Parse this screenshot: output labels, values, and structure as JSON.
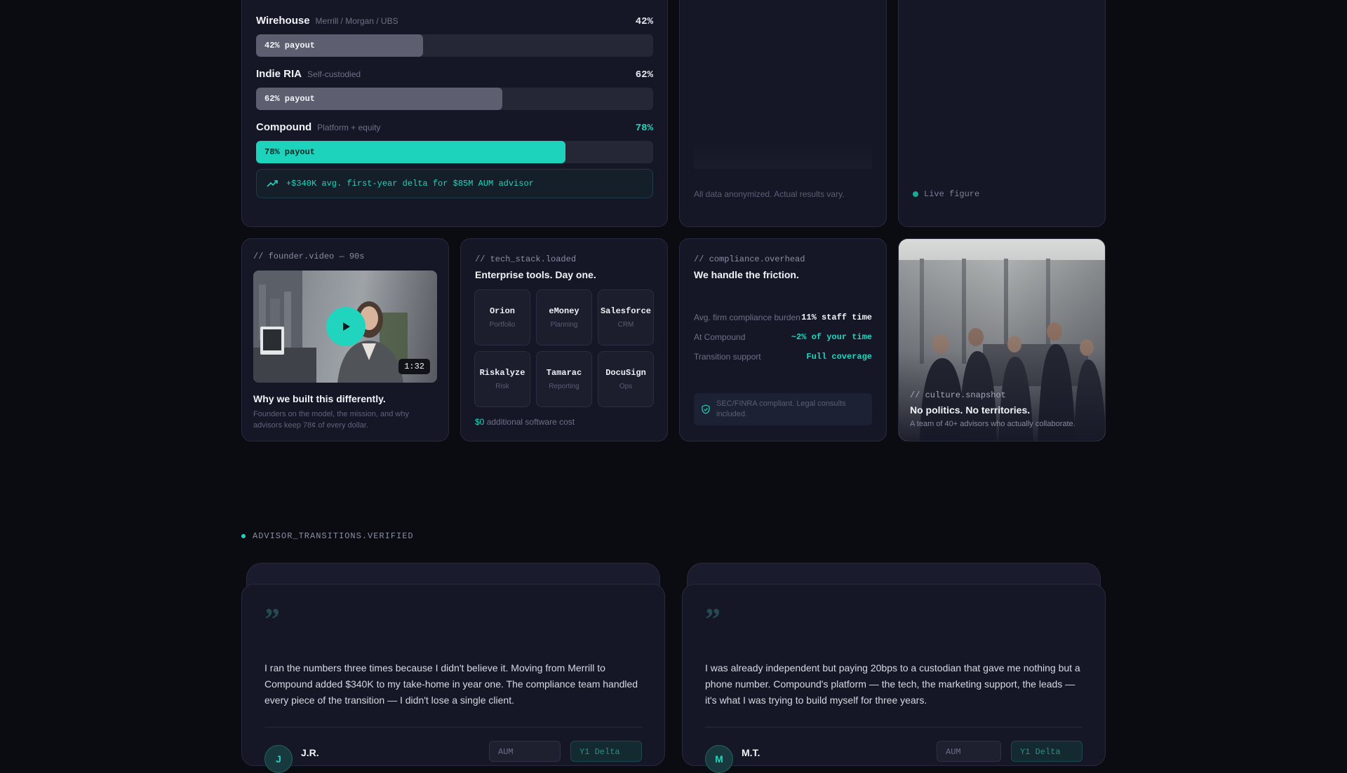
{
  "payout": {
    "rows": [
      {
        "name": "Wirehouse",
        "sub": "Merrill / Morgan / UBS",
        "pct": "42%",
        "bar_label": "42% payout",
        "value": 42,
        "accent": false
      },
      {
        "name": "Indie RIA",
        "sub": "Self-custodied",
        "pct": "62%",
        "bar_label": "62% payout",
        "value": 62,
        "accent": false
      },
      {
        "name": "Compound",
        "sub": "Platform + equity",
        "pct": "78%",
        "bar_label": "78% payout",
        "value": 78,
        "accent": true
      }
    ],
    "delta_text": "+$340K avg. first-year delta for $85M AUM advisor"
  },
  "disclaimer_card": {
    "note": "All data anonymized. Actual results vary."
  },
  "live_card": {
    "label": "Live figure"
  },
  "founder": {
    "label": "// founder.video — 90s",
    "duration": "1:32",
    "title": "Why we built this differently.",
    "desc": "Founders on the model, the mission, and why advisors keep 78¢ of every dollar."
  },
  "tech": {
    "label": "// tech_stack.loaded",
    "title": "Enterprise tools. Day one.",
    "tools": [
      {
        "name": "Orion",
        "role": "Portfolio"
      },
      {
        "name": "eMoney",
        "role": "Planning"
      },
      {
        "name": "Salesforce",
        "role": "CRM"
      },
      {
        "name": "Riskalyze",
        "role": "Risk"
      },
      {
        "name": "Tamarac",
        "role": "Reporting"
      },
      {
        "name": "DocuSign",
        "role": "Ops"
      }
    ],
    "cost_value": "$0",
    "cost_text": "additional software cost"
  },
  "compliance": {
    "label": "// compliance.overhead",
    "title": "We handle the friction.",
    "rows": [
      {
        "k": "Avg. firm compliance burden",
        "v": "11% staff time",
        "accent": false
      },
      {
        "k": "At Compound",
        "v": "~2% of your time",
        "accent": true
      },
      {
        "k": "Transition support",
        "v": "Full coverage",
        "accent": true
      }
    ],
    "badge": "SEC/FINRA compliant. Legal consults included."
  },
  "culture": {
    "label": "// culture.snapshot",
    "title": "No politics. No territories.",
    "desc": "A team of 40+ advisors who actually collaborate."
  },
  "section": {
    "label": "ADVISOR_TRANSITIONS.VERIFIED"
  },
  "testimonials": [
    {
      "quote": "I ran the numbers three times because I didn't believe it. Moving from Merrill to Compound added $340K to my take-home in year one. The compliance team handled every piece of the transition — I didn't lose a single client.",
      "initial": "J",
      "name": "J.R.",
      "aum_label": "AUM",
      "delta_label": "Y1 Delta"
    },
    {
      "quote": "I was already independent but paying 20bps to a custodian that gave me nothing but a phone number. Compound's platform — the tech, the marketing support, the leads — it's what I was trying to build myself for three years.",
      "initial": "M",
      "name": "M.T.",
      "aum_label": "AUM",
      "delta_label": "Y1 Delta"
    }
  ],
  "quote_glyph": "”",
  "colors": {
    "accent": "#1dd3bc",
    "card": "#161726",
    "background": "#0b0c12"
  }
}
